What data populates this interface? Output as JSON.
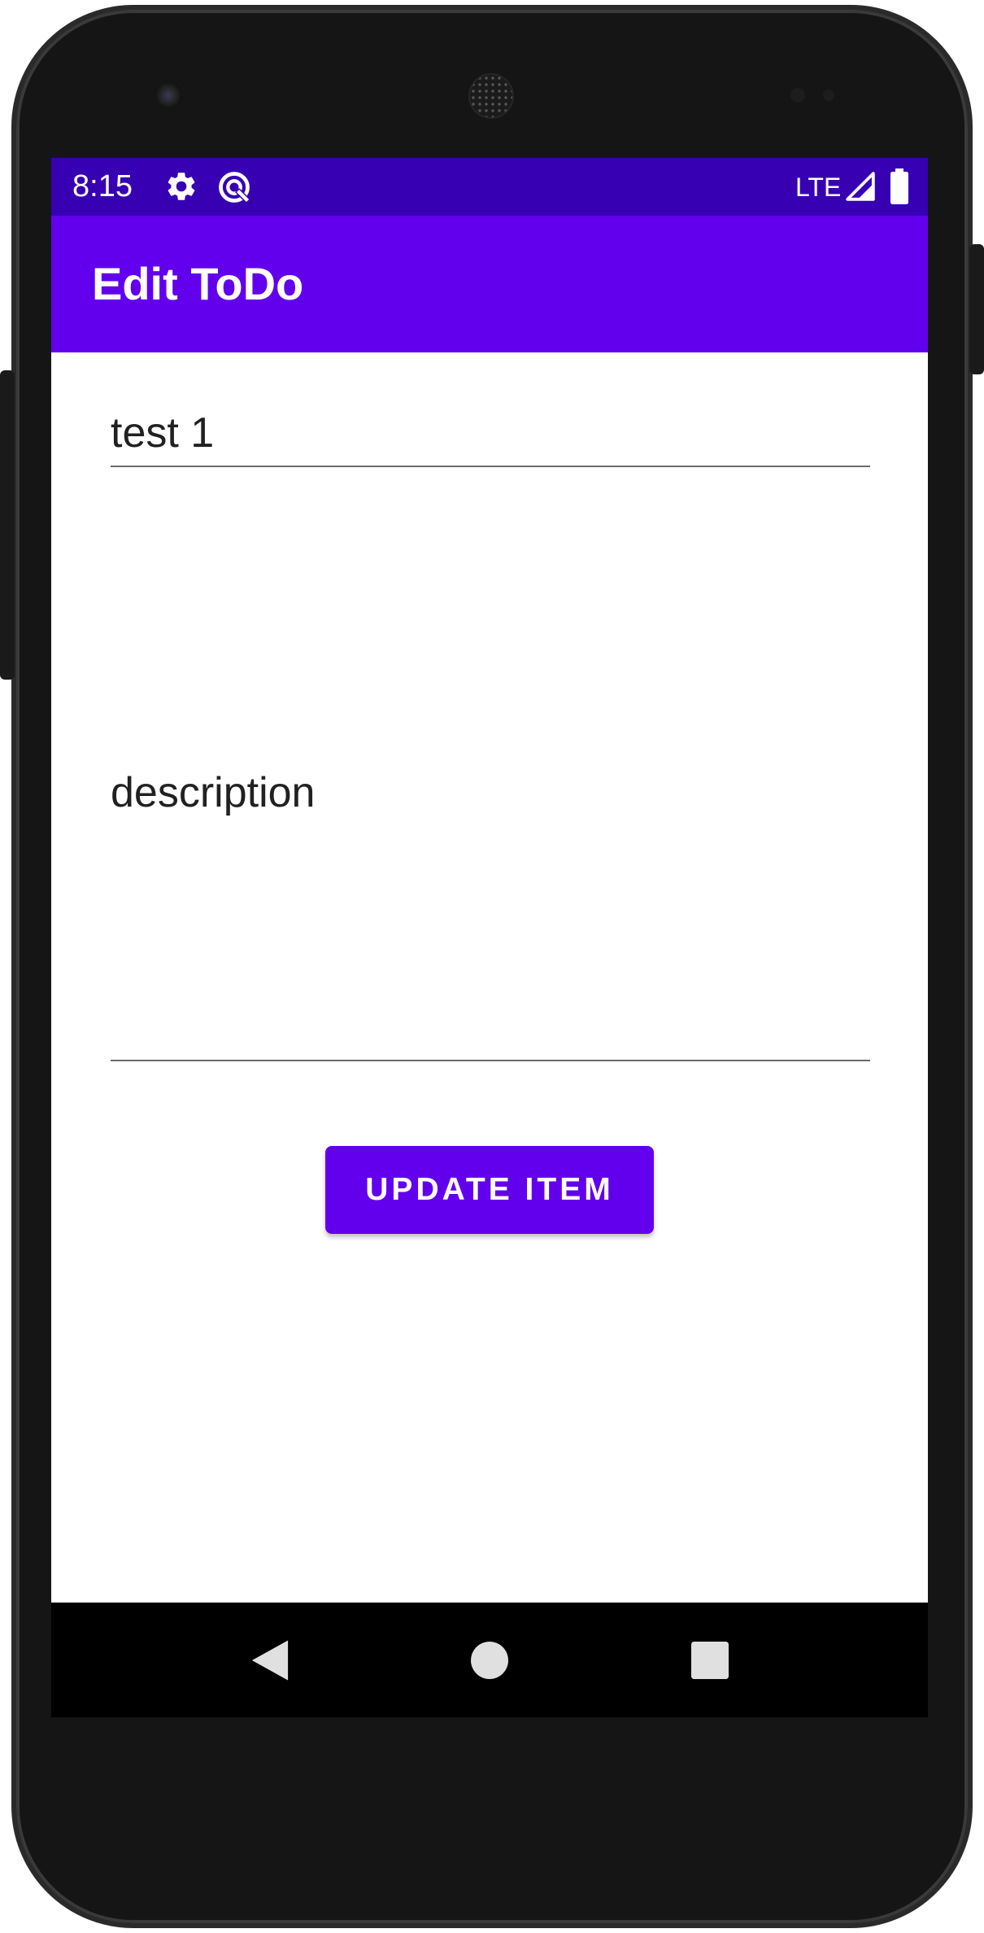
{
  "status_bar": {
    "time": "8:15",
    "network": "LTE",
    "icons": [
      "gear-icon",
      "sync-icon",
      "signal-icon",
      "battery-icon"
    ]
  },
  "app_bar": {
    "title": "Edit ToDo"
  },
  "form": {
    "title_value": "test 1",
    "description_value": "description",
    "update_button_label": "UPDATE ITEM"
  },
  "nav_bar": {
    "icons": [
      "back-icon",
      "home-icon",
      "recents-icon"
    ]
  },
  "colors": {
    "status_bar": "#3700b3",
    "primary": "#6200ee",
    "text": "#212121"
  }
}
